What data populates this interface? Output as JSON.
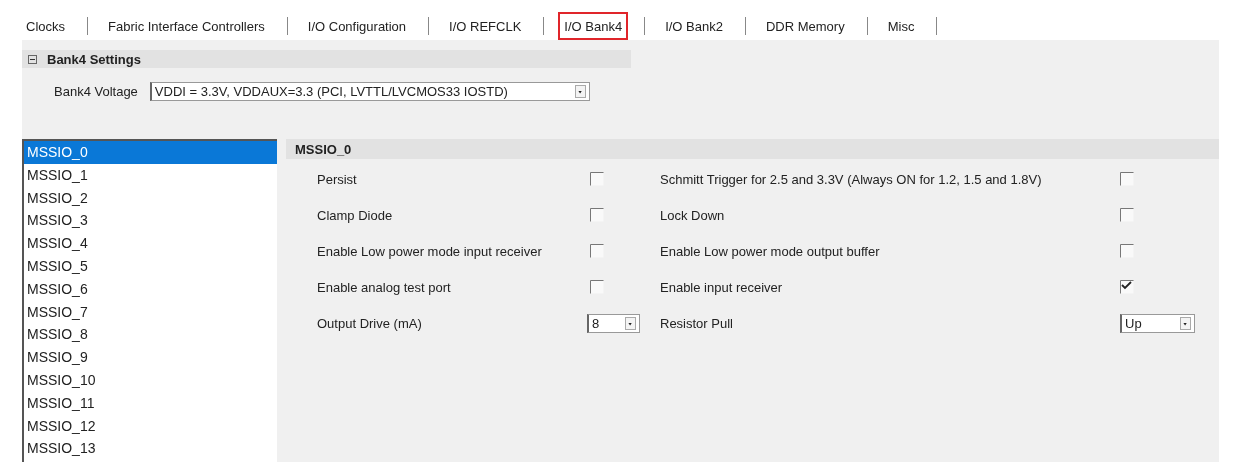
{
  "tabs": [
    {
      "label": "Clocks",
      "selected": false
    },
    {
      "label": "Fabric Interface Controllers",
      "selected": false
    },
    {
      "label": "I/O Configuration",
      "selected": false
    },
    {
      "label": "I/O REFCLK",
      "selected": false
    },
    {
      "label": "I/O Bank4",
      "selected": true
    },
    {
      "label": "I/O Bank2",
      "selected": false
    },
    {
      "label": "DDR Memory",
      "selected": false
    },
    {
      "label": "Misc",
      "selected": false
    }
  ],
  "bank_settings": {
    "title": "Bank4 Settings",
    "expanded": true,
    "voltage_label": "Bank4 Voltage",
    "voltage_value": "VDDI = 3.3V, VDDAUX=3.3 (PCI, LVTTL/LVCMOS33 IOSTD)"
  },
  "io_list": [
    {
      "label": "MSSIO_0",
      "selected": true
    },
    {
      "label": "MSSIO_1",
      "selected": false
    },
    {
      "label": "MSSIO_2",
      "selected": false
    },
    {
      "label": "MSSIO_3",
      "selected": false
    },
    {
      "label": "MSSIO_4",
      "selected": false
    },
    {
      "label": "MSSIO_5",
      "selected": false
    },
    {
      "label": "MSSIO_6",
      "selected": false
    },
    {
      "label": "MSSIO_7",
      "selected": false
    },
    {
      "label": "MSSIO_8",
      "selected": false
    },
    {
      "label": "MSSIO_9",
      "selected": false
    },
    {
      "label": "MSSIO_10",
      "selected": false
    },
    {
      "label": "MSSIO_11",
      "selected": false
    },
    {
      "label": "MSSIO_12",
      "selected": false
    },
    {
      "label": "MSSIO_13",
      "selected": false
    }
  ],
  "io_panel": {
    "title": "MSSIO_0",
    "left_settings": [
      {
        "kind": "checkbox",
        "label": "Persist",
        "checked": false
      },
      {
        "kind": "checkbox",
        "label": "Clamp Diode",
        "checked": false
      },
      {
        "kind": "checkbox",
        "label": "Enable Low power mode input receiver",
        "checked": false
      },
      {
        "kind": "checkbox",
        "label": "Enable analog test port",
        "checked": false
      },
      {
        "kind": "select",
        "label": "Output Drive (mA)",
        "value": "8"
      }
    ],
    "right_settings": [
      {
        "kind": "checkbox",
        "label": "Schmitt Trigger for 2.5 and 3.3V (Always ON for 1.2, 1.5 and 1.8V)",
        "checked": false
      },
      {
        "kind": "checkbox",
        "label": "Lock Down",
        "checked": false
      },
      {
        "kind": "checkbox",
        "label": "Enable Low power mode output buffer",
        "checked": false
      },
      {
        "kind": "checkbox",
        "label": "Enable input receiver",
        "checked": true
      },
      {
        "kind": "select",
        "label": "Resistor Pull",
        "value": "Up"
      }
    ]
  }
}
